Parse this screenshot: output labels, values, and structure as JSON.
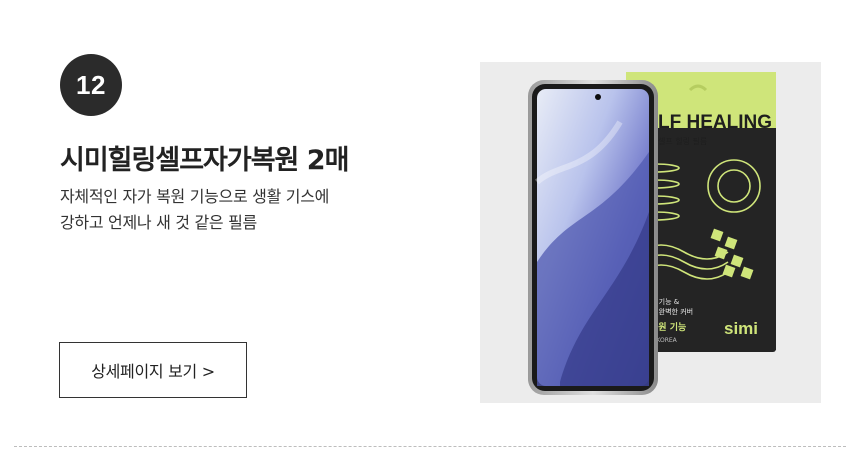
{
  "item": {
    "number": "12",
    "title": "시미힐링셀프자가복원 2매",
    "description_lines": [
      "자체적인 자가 복원 기능으로 생활 기스에",
      "강하고 언제나 새 것 같은 필름"
    ],
    "detail_button_label": "상세페이지 보기 >"
  },
  "product_image": {
    "package_heading": "LF HEALING",
    "package_subheading": "셀프 힐링 필름",
    "package_feature_line1": "지 기능 &",
    "package_feature_line2": "지 완벽한 커버",
    "package_restore_label": "복원 기능",
    "package_origin": "N KOREA",
    "brand_logo": "simi"
  },
  "colors": {
    "badge_bg": "#2b2b2b",
    "package_accent": "#cfe57a",
    "package_dark": "#242424",
    "image_bg": "#ececec"
  }
}
